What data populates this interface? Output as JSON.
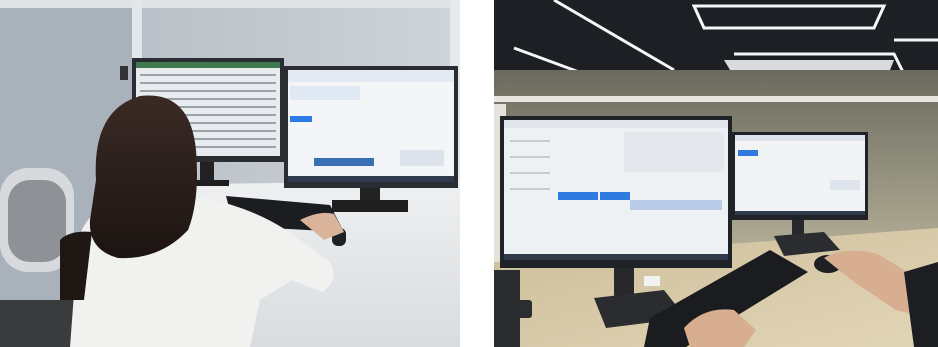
{
  "photos": [
    {
      "subject": "person-at-dual-monitor-desk"
    },
    {
      "subject": "dual-monitor-workstation-with-keyboard"
    }
  ]
}
